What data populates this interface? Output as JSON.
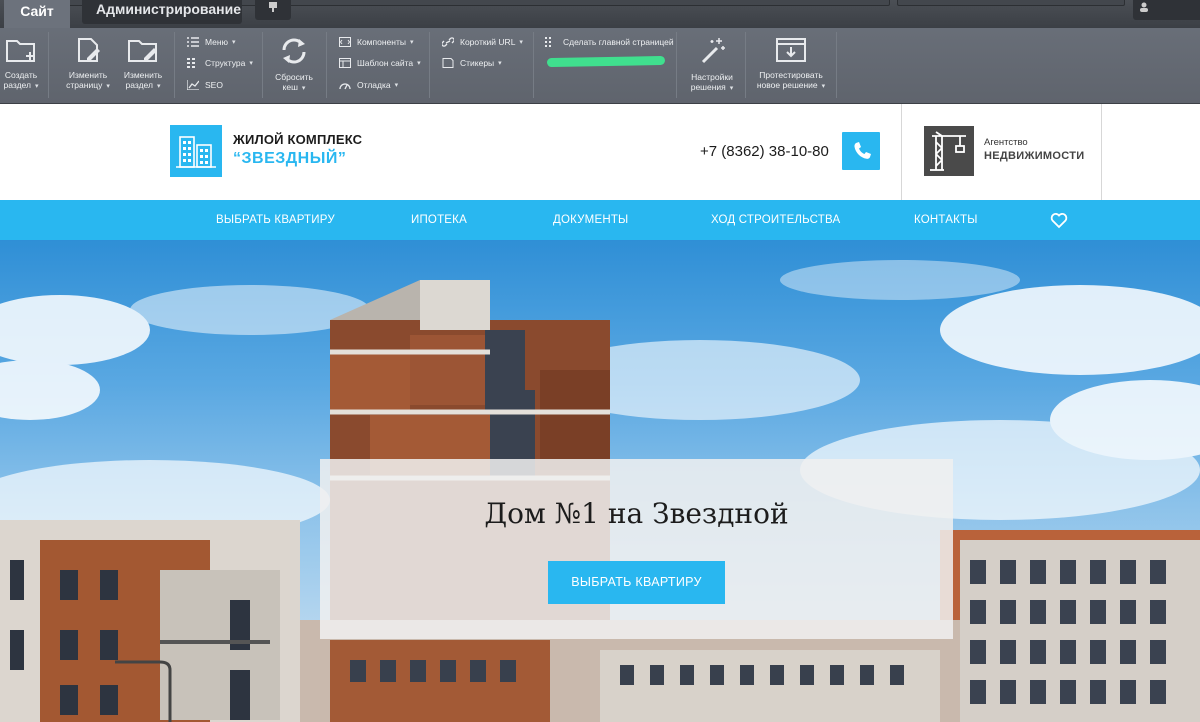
{
  "admin": {
    "tabs": {
      "site": "Сайт",
      "administration": "Администрирование"
    },
    "buttons": {
      "create_section": [
        "Создать",
        "раздел"
      ],
      "edit_page": [
        "Изменить",
        "страницу"
      ],
      "edit_section": [
        "Изменить",
        "раздел"
      ],
      "reset_cache": [
        "Сбросить",
        "кеш"
      ],
      "solution_settings": [
        "Настройки",
        "решения"
      ],
      "test_solution": [
        "Протестировать",
        "новое решение"
      ]
    },
    "col1": {
      "menu": "Меню",
      "structure": "Структура",
      "seo": "SEO"
    },
    "col2": {
      "components": "Компоненты",
      "site_template": "Шаблон сайта",
      "debug": "Отладка"
    },
    "col3": {
      "short_url": "Короткий URL",
      "stickers": "Стикеры"
    },
    "col4": {
      "make_home": "Сделать главной страницей"
    }
  },
  "header": {
    "logo_line1": "ЖИЛОЙ КОМПЛЕКС",
    "logo_line2": "“ЗВЕЗДНЫЙ”",
    "phone": "+7 (8362) 38-10-80",
    "agency_line1": "Агентство",
    "agency_line2": "НЕДВИЖИМОСТИ"
  },
  "nav": {
    "items": [
      "ВЫБРАТЬ КВАРТИРУ",
      "ИПОТЕКА",
      "ДОКУМЕНТЫ",
      "ХОД СТРОИТЕЛЬСТВА",
      "КОНТАКТЫ"
    ]
  },
  "hero": {
    "title": "Дом №1 на Звездной",
    "button": "ВЫБРАТЬ КВАРТИРУ"
  },
  "colors": {
    "accent": "#29b7f0",
    "admin_bg": "#666c75"
  }
}
